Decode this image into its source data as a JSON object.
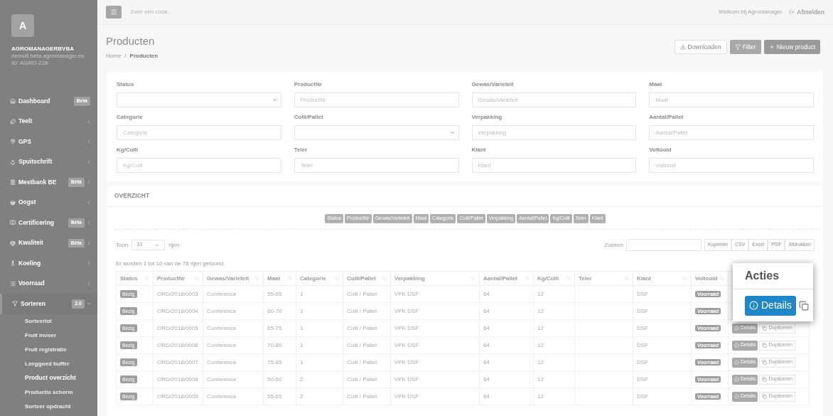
{
  "sidebar": {
    "avatar": "A",
    "company": "AGROMANAGERBVBA",
    "domain": "demo8.beta.agromanager.eu",
    "account_id": "ID: AGRO-228",
    "items": [
      {
        "label": "Dashboard",
        "badge": "Beta",
        "selected": false
      },
      {
        "label": "Teelt",
        "expanded": false,
        "selected": false
      },
      {
        "label": "GPS",
        "expanded": false,
        "selected": false
      },
      {
        "label": "Spuitschrift",
        "expanded": false,
        "selected": false
      },
      {
        "label": "Mestbank BE",
        "badge": "Bèta",
        "expanded": false,
        "selected": false
      },
      {
        "label": "Oogst",
        "expanded": false,
        "selected": false
      },
      {
        "label": "Certificering",
        "badge": "Bèta",
        "expanded": false,
        "selected": false
      },
      {
        "label": "Kwaliteit",
        "badge": "Bèta",
        "expanded": false,
        "selected": false
      },
      {
        "label": "Koeling",
        "expanded": false,
        "selected": false
      },
      {
        "label": "Voorraad",
        "expanded": false,
        "selected": false
      },
      {
        "label": "Sorteren",
        "badge": "2.0",
        "expanded": true,
        "selected": true,
        "children": [
          {
            "label": "Sorteerlot",
            "selected": false
          },
          {
            "label": "Fruit invoer",
            "selected": false
          },
          {
            "label": "Fruit registratie",
            "selected": false
          },
          {
            "label": "Leeggoed buffer",
            "selected": false
          },
          {
            "label": "Product overzicht",
            "selected": true
          },
          {
            "label": "Productie scherm",
            "selected": false
          },
          {
            "label": "Sorteer opdracht",
            "selected": false
          }
        ]
      }
    ]
  },
  "topbar": {
    "search_placeholder": "Zoek een code...",
    "welcome": "Welkom bij Agromanager.",
    "logout": "Afmelden"
  },
  "header": {
    "title": "Producten",
    "breadcrumb": [
      "Home",
      "Producten"
    ],
    "breadcrumb_separator": "/",
    "buttons": [
      {
        "label": "Downloaden",
        "kind": "download"
      },
      {
        "label": "Filter",
        "kind": "filter"
      },
      {
        "label": "Nieuw product",
        "kind": "new"
      }
    ]
  },
  "filters": [
    {
      "label": "Status",
      "kind": "select"
    },
    {
      "label": "ProductNr",
      "placeholder": "ProductNr"
    },
    {
      "label": "Gewas/Varieteit",
      "placeholder": "Gewas/Varieteit"
    },
    {
      "label": "Maat",
      "placeholder": "Maat"
    },
    {
      "label": "Categorie",
      "placeholder": "Categorie"
    },
    {
      "label": "Colli/Pallet",
      "kind": "select"
    },
    {
      "label": "Verpakking",
      "placeholder": "Verpakking"
    },
    {
      "label": "Aantal/Pallet",
      "placeholder": "Aantal/Pallet"
    },
    {
      "label": "Kg/Colli",
      "placeholder": "Kg/Colli"
    },
    {
      "label": "Teler",
      "placeholder": "Teler"
    },
    {
      "label": "Klant",
      "placeholder": "Klant"
    },
    {
      "label": "Voltooid",
      "placeholder": "Voltooid"
    }
  ],
  "overview": {
    "title": "OVERZICHT",
    "column_toggles": [
      "Status",
      "ProductNr",
      "Gewas/Varieteit",
      "Maat",
      "Categorie",
      "Colli/Pallet",
      "Verpakking",
      "Aantal/Pallet",
      "Kg/Colli",
      "Teler",
      "Klant"
    ],
    "show_label": "Toon",
    "page_size": "10",
    "rows_label": "rijen",
    "search_label": "Zoeken",
    "export_buttons": [
      "Kopieren",
      "CSV",
      "Excel",
      "PDF",
      "Afdrukken"
    ],
    "info": "Er worden 1 tot 10 van de 76 rijen getoond",
    "columns": [
      "Status",
      "ProductNr",
      "Gewas/Varieteit",
      "Maat",
      "Categorie",
      "Colli/Pallet",
      "Verpakking",
      "Aantal/Pallet",
      "Kg/Colli",
      "Teler",
      "Klant",
      "Voltooid"
    ],
    "rows": [
      {
        "status": "Bezig",
        "nr": "ORD/2018/0003",
        "gewas": "Conference",
        "maat": "55-65",
        "categorie": "1",
        "colli": "Colli / Pallet",
        "verpakking": "VPK DSF",
        "aantal": "64",
        "kg": "12",
        "klant": "DSF",
        "voltooid": "Voorraad"
      },
      {
        "status": "Bezig",
        "nr": "ORD/2018/0004",
        "gewas": "Conference",
        "maat": "60-70",
        "categorie": "1",
        "colli": "Colli / Pallet",
        "verpakking": "VPK DSF",
        "aantal": "64",
        "kg": "12",
        "klant": "DSF",
        "voltooid": "Voorraad"
      },
      {
        "status": "Bezig",
        "nr": "ORD/2018/0005",
        "gewas": "Conference",
        "maat": "65-75",
        "categorie": "1",
        "colli": "Colli / Pallet",
        "verpakking": "VPK DSF",
        "aantal": "64",
        "kg": "12",
        "klant": "DSF",
        "voltooid": "Voorraad",
        "actions": [
          "Details",
          "Dupliceren"
        ]
      },
      {
        "status": "Bezig",
        "nr": "ORD/2018/0006",
        "gewas": "Conference",
        "maat": "70-80",
        "categorie": "1",
        "colli": "Colli / Pallet",
        "verpakking": "VPK DSF",
        "aantal": "64",
        "kg": "12",
        "klant": "DSF",
        "voltooid": "Voorraad",
        "actions": [
          "Details",
          "Dupliceren"
        ]
      },
      {
        "status": "Bezig",
        "nr": "ORD/2018/0007",
        "gewas": "Conference",
        "maat": "75-85",
        "categorie": "1",
        "colli": "Colli / Pallet",
        "verpakking": "VPK DSF",
        "aantal": "64",
        "kg": "12",
        "klant": "DSF",
        "voltooid": "Voorraad",
        "actions": [
          "Details",
          "Dupliceren"
        ]
      },
      {
        "status": "Bezig",
        "nr": "ORD/2018/0008",
        "gewas": "Conference",
        "maat": "50-60",
        "categorie": "2",
        "colli": "Colli / Pallet",
        "verpakking": "VPK DSF",
        "aantal": "64",
        "kg": "12",
        "klant": "DSF",
        "voltooid": "Voorraad",
        "actions": [
          "Details",
          "Dupliceren"
        ]
      },
      {
        "status": "Bezig",
        "nr": "ORD/2018/0009",
        "gewas": "Conference",
        "maat": "55-65",
        "categorie": "2",
        "colli": "Colli / Pallet",
        "verpakking": "VPK DSF",
        "aantal": "64",
        "kg": "12",
        "klant": "DSF",
        "voltooid": "Voorraad",
        "actions": [
          "Details",
          "Dupliceren"
        ]
      }
    ]
  },
  "zoom_callout": {
    "header": "Acties",
    "button": "Details"
  }
}
